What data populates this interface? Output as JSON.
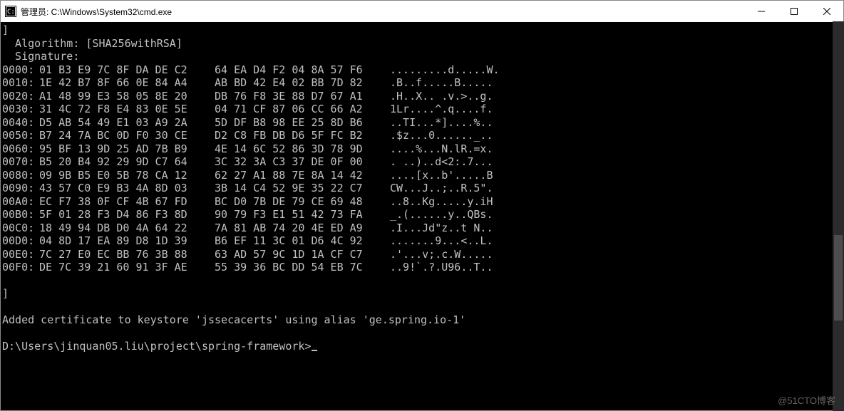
{
  "window": {
    "title": "管理员: C:\\Windows\\System32\\cmd.exe"
  },
  "terminal": {
    "pre_lines": [
      "]",
      "  Algorithm: [SHA256withRSA]",
      "  Signature:"
    ],
    "hex_rows": [
      {
        "offset": "0000:",
        "h1": "01 B3 E9 7C 8F DA DE C2",
        "h2": "64 EA D4 F2 04 8A 57 F6",
        "asc": ".........d.....W."
      },
      {
        "offset": "0010:",
        "h1": "1E 42 B7 8F 66 0E 84 A4",
        "h2": "AB BD 42 E4 02 BB 7D 82",
        "asc": ".B..f.....B....."
      },
      {
        "offset": "0020:",
        "h1": "A1 48 99 E3 58 05 8E 20",
        "h2": "DB 76 F8 3E 88 D7 67 A1",
        "asc": ".H..X.. .v.>..g."
      },
      {
        "offset": "0030:",
        "h1": "31 4C 72 F8 E4 83 0E 5E",
        "h2": "04 71 CF 87 06 CC 66 A2",
        "asc": "1Lr....^.q....f."
      },
      {
        "offset": "0040:",
        "h1": "D5 AB 54 49 E1 03 A9 2A",
        "h2": "5D DF B8 98 EE 25 8D B6",
        "asc": "..TI...*]....%.."
      },
      {
        "offset": "0050:",
        "h1": "B7 24 7A BC 0D F0 30 CE",
        "h2": "D2 C8 FB DB D6 5F FC B2",
        "asc": ".$z...0......_.."
      },
      {
        "offset": "0060:",
        "h1": "95 BF 13 9D 25 AD 7B B9",
        "h2": "4E 14 6C 52 86 3D 78 9D",
        "asc": "....%...N.lR.=x."
      },
      {
        "offset": "0070:",
        "h1": "B5 20 B4 92 29 9D C7 64",
        "h2": "3C 32 3A C3 37 DE 0F 00",
        "asc": ". ..)..d<2:.7..."
      },
      {
        "offset": "0080:",
        "h1": "09 9B B5 E0 5B 78 CA 12",
        "h2": "62 27 A1 88 7E 8A 14 42",
        "asc": "....[x..b'.....B"
      },
      {
        "offset": "0090:",
        "h1": "43 57 C0 E9 B3 4A 8D 03",
        "h2": "3B 14 C4 52 9E 35 22 C7",
        "asc": "CW...J..;..R.5\"."
      },
      {
        "offset": "00A0:",
        "h1": "EC F7 38 0F CF 4B 67 FD",
        "h2": "BC D0 7B DE 79 CE 69 48",
        "asc": "..8..Kg.....y.iH"
      },
      {
        "offset": "00B0:",
        "h1": "5F 01 28 F3 D4 86 F3 8D",
        "h2": "90 79 F3 E1 51 42 73 FA",
        "asc": "_.(......y..QBs."
      },
      {
        "offset": "00C0:",
        "h1": "18 49 94 DB D0 4A 64 22",
        "h2": "7A 81 AB 74 20 4E ED A9",
        "asc": ".I...Jd\"z..t N.."
      },
      {
        "offset": "00D0:",
        "h1": "04 8D 17 EA 89 D8 1D 39",
        "h2": "B6 EF 11 3C 01 D6 4C 92",
        "asc": ".......9...<..L."
      },
      {
        "offset": "00E0:",
        "h1": "7C 27 E0 EC BB 76 3B 88",
        "h2": "63 AD 57 9C 1D 1A CF C7",
        "asc": ".'...v;.c.W....."
      },
      {
        "offset": "00F0:",
        "h1": "DE 7C 39 21 60 91 3F AE",
        "h2": "55 39 36 BC DD 54 EB 7C",
        "asc": "..9!`.?.U96..T.."
      }
    ],
    "post_lines": [
      "",
      "]",
      "",
      "Added certificate to keystore 'jssecacerts' using alias 'ge.spring.io-1'",
      ""
    ],
    "prompt": "D:\\Users\\jinquan05.liu\\project\\spring-framework>"
  },
  "watermark": "@51CTO博客"
}
